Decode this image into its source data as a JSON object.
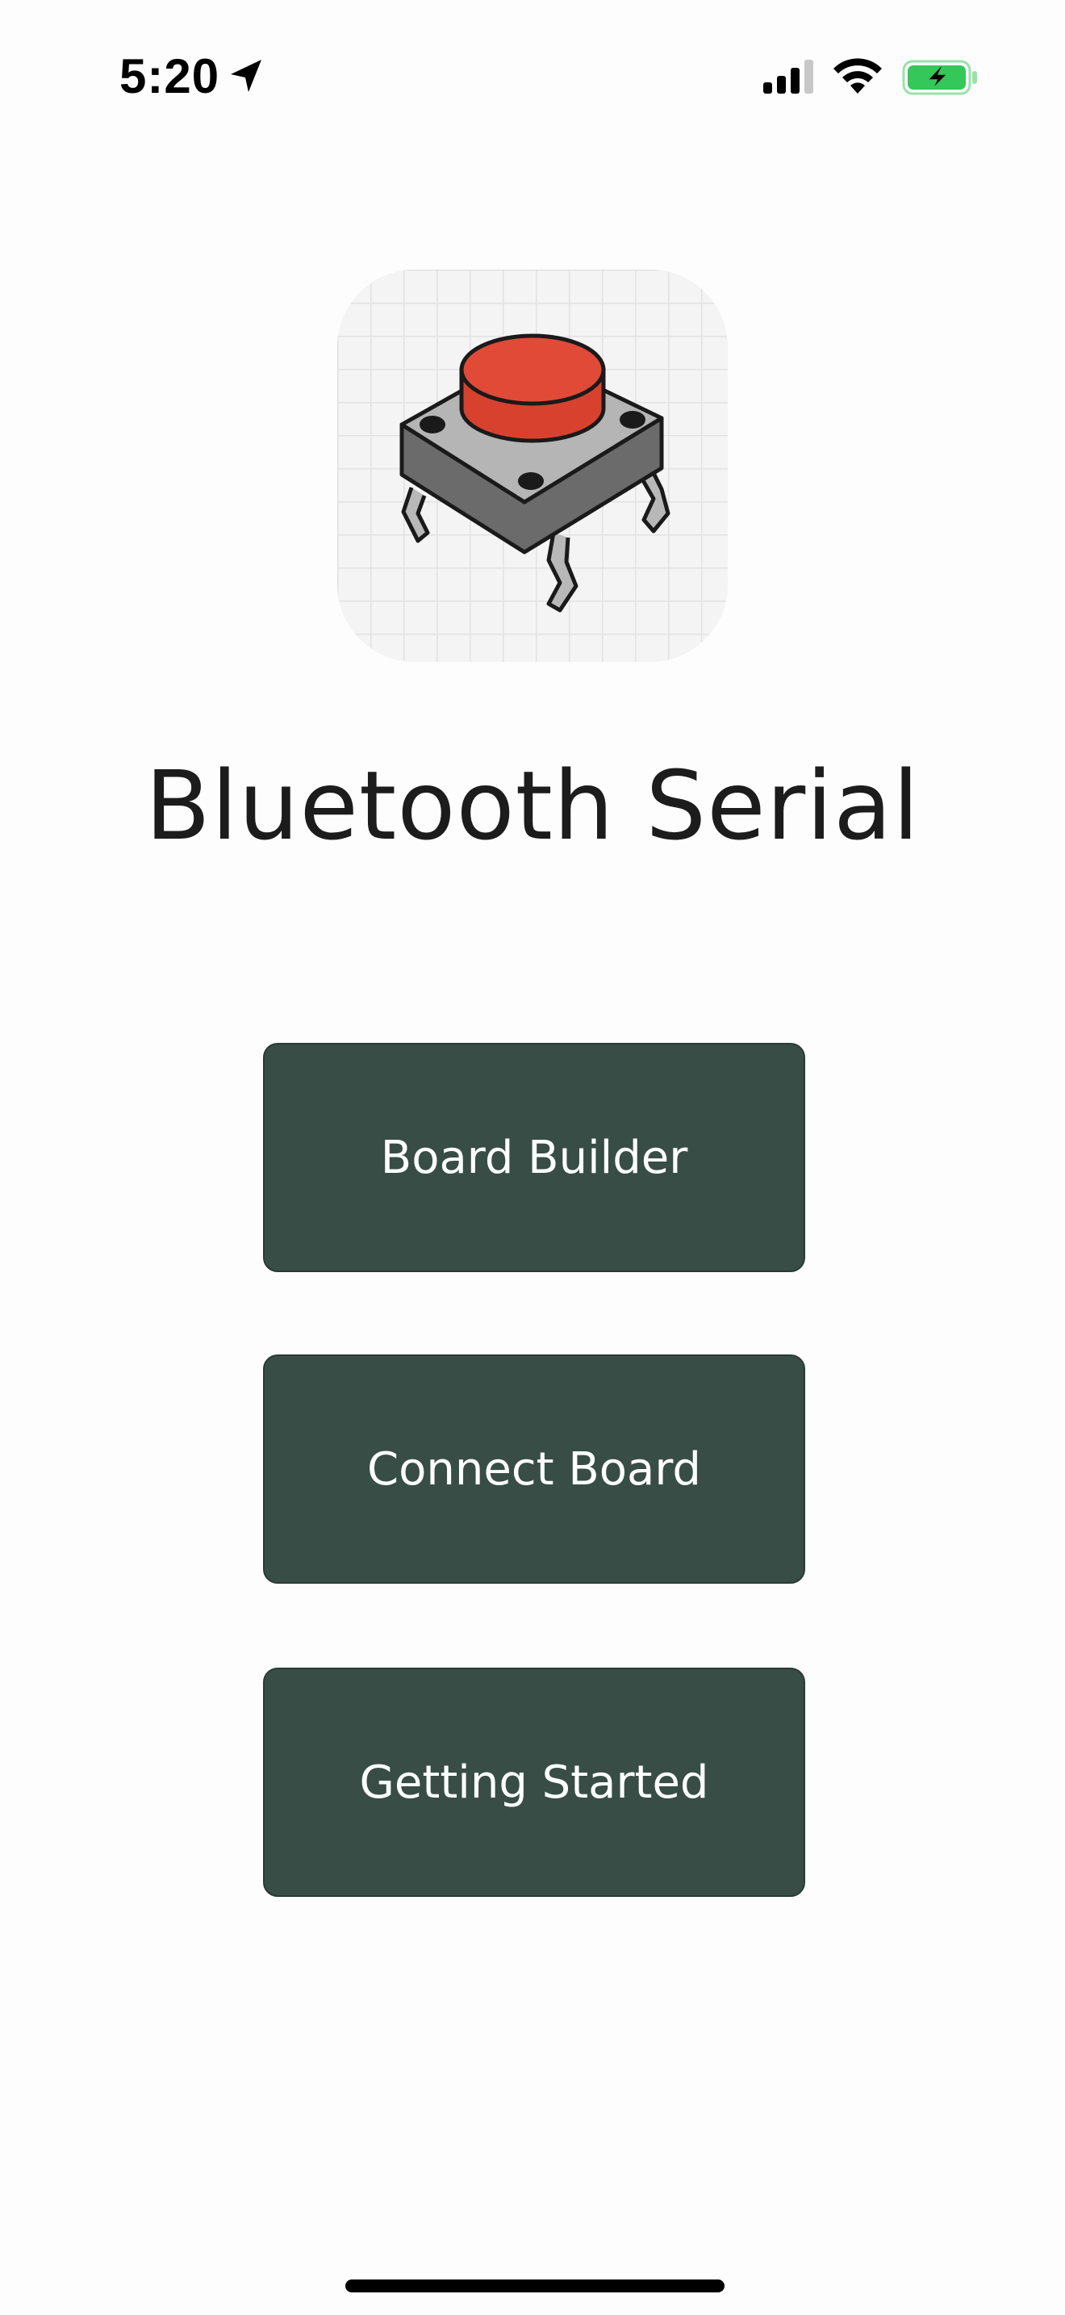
{
  "status_bar": {
    "time": "5:20",
    "icons": [
      "location-arrow-icon",
      "cellular-signal-icon",
      "wifi-icon",
      "battery-charging-icon"
    ],
    "battery_color": "#34c759"
  },
  "app": {
    "title": "Bluetooth Serial",
    "icon": "tactile-push-button-icon",
    "accent_color": "#d9412f"
  },
  "menu": {
    "board_builder_label": "Board Builder",
    "connect_board_label": "Connect Board",
    "getting_started_label": "Getting Started",
    "button_color": "#374d46"
  }
}
